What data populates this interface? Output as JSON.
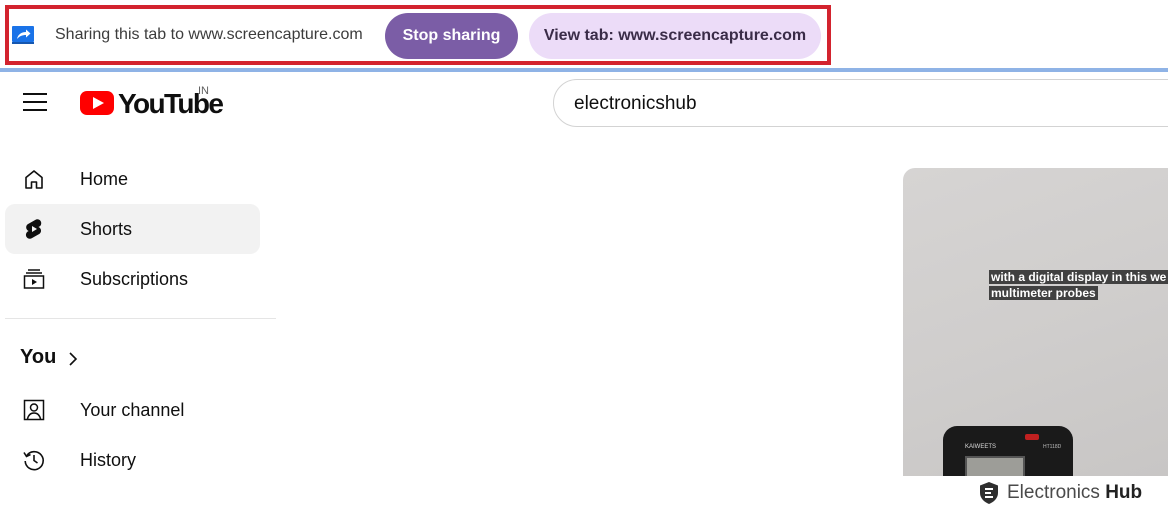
{
  "share_bar": {
    "message": "Sharing this tab to www.screencapture.com",
    "stop_label": "Stop sharing",
    "view_label": "View tab: www.screencapture.com",
    "icon": "share-screen-icon",
    "colors": {
      "highlight_border": "#d3232e",
      "stop_bg": "#7b5da6",
      "view_bg": "#ecdcf8"
    }
  },
  "header": {
    "logo_text": "YouTube",
    "region": "IN",
    "search_value": "electronicshub",
    "icons": [
      "menu-icon",
      "youtube-logo-icon"
    ]
  },
  "sidebar": {
    "items": [
      {
        "label": "Home",
        "icon": "home-icon",
        "active": false
      },
      {
        "label": "Shorts",
        "icon": "shorts-icon",
        "active": true
      },
      {
        "label": "Subscriptions",
        "icon": "subscriptions-icon",
        "active": false
      }
    ],
    "you_section": {
      "title": "You",
      "items": [
        {
          "label": "Your channel",
          "icon": "your-channel-icon"
        },
        {
          "label": "History",
          "icon": "history-icon"
        }
      ]
    }
  },
  "video": {
    "caption_line1": "with a digital display in this we",
    "caption_line2": "multimeter probes",
    "device_brand": "KAIWEETS",
    "device_model": "HT118D"
  },
  "watermark": {
    "text_regular": "Electronics ",
    "text_bold": "Hub",
    "icon": "electronics-hub-shield-icon"
  }
}
